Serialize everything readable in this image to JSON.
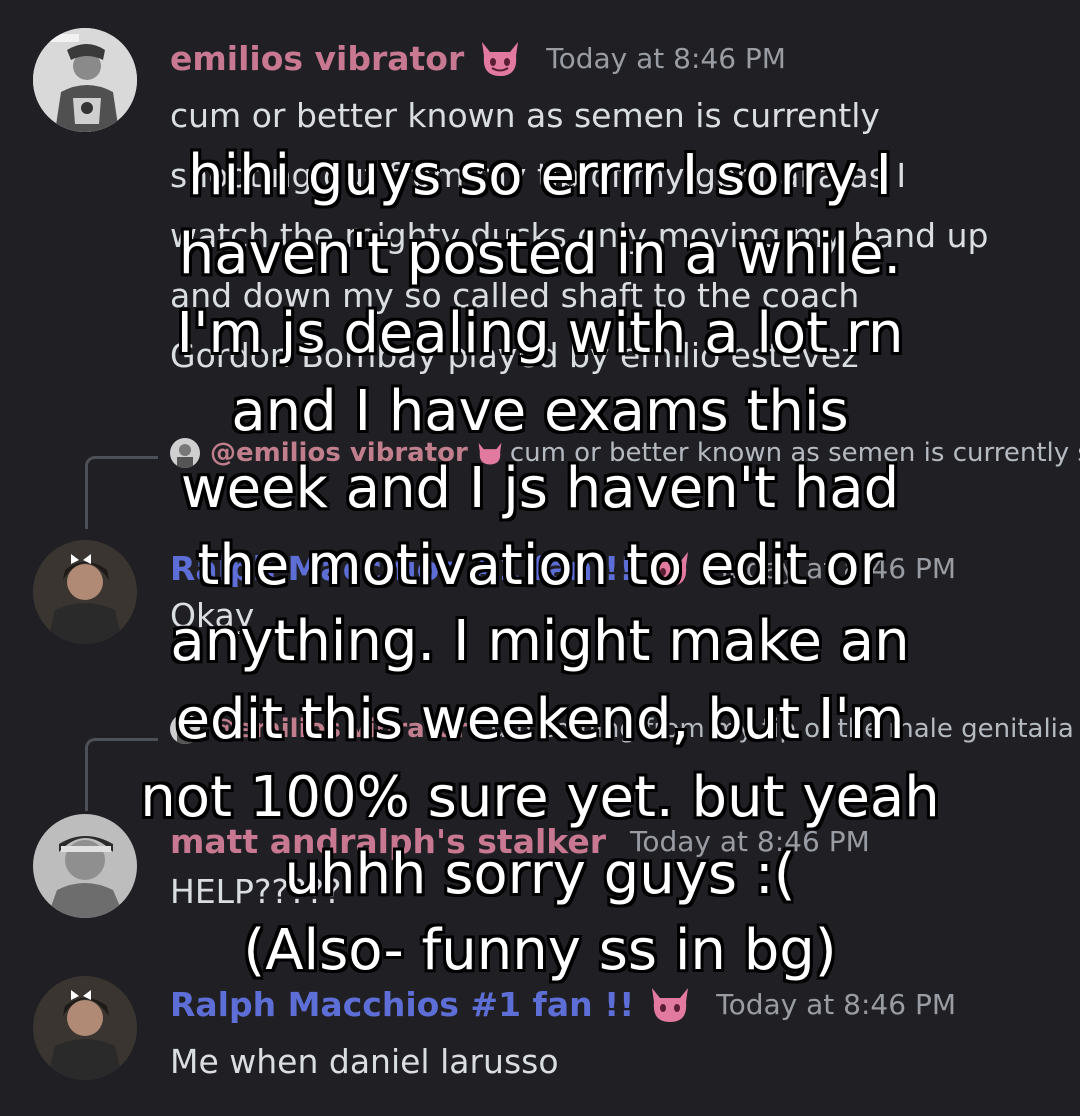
{
  "colors": {
    "background": "#202024",
    "username_pink": "#c87890",
    "username_blue": "#5d6ed6",
    "timestamp": "#9a9ca3",
    "message_text": "#dbdee1",
    "overlay_text": "#ffffff",
    "overlay_outline": "#000000"
  },
  "messages": [
    {
      "username": "emilios vibrator",
      "timestamp": "Today at 8:46 PM",
      "emoji": "devil-face-icon",
      "lines": [
        "cum or better known as semen is currently",
        "shooting out from my tip of my genitalia as I",
        "watch the mighty ducks only moving my hand up",
        "and down my so called shaft to the coach",
        "Gordon Bombay played by emilio estevez"
      ]
    },
    {
      "reply_name": "@emilios vibrator",
      "reply_text": "cum or better known as semen is currently shooting out from my tip of my genitalia as I watch",
      "username": "Ralph Macchios #1 fan !!",
      "timestamp": "Today at 8:46 PM",
      "emoji": "devil-face-icon",
      "lines": [
        "Okay"
      ]
    },
    {
      "reply_name": "@emilios vibrator",
      "reply_text": "cum coming from my tip of the male genitalia as I watch",
      "username": "matt andralph's stalker",
      "timestamp": "Today at 8:46 PM",
      "lines": [
        "HELP?????"
      ]
    },
    {
      "username": "Ralph Macchios #1 fan !!",
      "timestamp": "Today at 8:46 PM",
      "emoji": "devil-face-icon",
      "lines": [
        "Me when daniel larusso"
      ]
    }
  ],
  "overlay": {
    "lines": [
      "hihi guys so errrr I sorry I",
      "haven't posted in a while.",
      "I'm js dealing with a lot rn",
      "and I have exams this",
      "week and I js haven't had",
      "the motivation to edit or",
      "anything. I might make an",
      "edit this weekend, but I'm",
      "not 100% sure yet. but yeah",
      "uhhh sorry guys :(",
      "(Also- funny ss in bg)"
    ]
  }
}
